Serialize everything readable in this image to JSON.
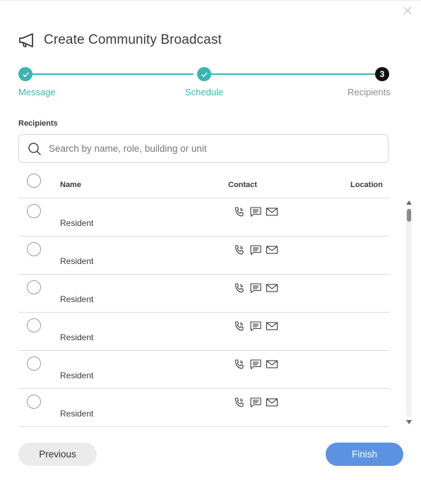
{
  "modal": {
    "title": "Create Community Broadcast",
    "title_icon": "megaphone-icon",
    "close_icon": "close-icon"
  },
  "stepper": {
    "steps": [
      {
        "label": "Message",
        "state": "done"
      },
      {
        "label": "Schedule",
        "state": "done"
      },
      {
        "label": "Recipients",
        "state": "current",
        "number": "3"
      }
    ],
    "accent_color": "#3cb4b4"
  },
  "recipients": {
    "section_label": "Recipients",
    "search_placeholder": "Search by name, role, building or unit",
    "search_value": "",
    "columns": {
      "name": "Name",
      "contact": "Contact",
      "location": "Location"
    },
    "rows": [
      {
        "name": "",
        "role": "Resident",
        "location": "",
        "contact_icons": [
          "phone-icon",
          "sms-icon",
          "email-icon"
        ]
      },
      {
        "name": "",
        "role": "Resident",
        "location": "",
        "contact_icons": [
          "phone-icon",
          "sms-icon",
          "email-icon"
        ]
      },
      {
        "name": "",
        "role": "Resident",
        "location": "",
        "contact_icons": [
          "phone-icon",
          "sms-icon",
          "email-icon"
        ]
      },
      {
        "name": "",
        "role": "Resident",
        "location": "",
        "contact_icons": [
          "phone-icon",
          "sms-icon",
          "email-icon"
        ]
      },
      {
        "name": "",
        "role": "Resident",
        "location": "",
        "contact_icons": [
          "phone-icon",
          "sms-icon",
          "email-icon"
        ]
      },
      {
        "name": "",
        "role": "Resident",
        "location": "",
        "contact_icons": [
          "phone-icon",
          "sms-icon",
          "email-icon"
        ]
      }
    ]
  },
  "footer": {
    "previous_label": "Previous",
    "finish_label": "Finish",
    "finish_color": "#5b93e2"
  }
}
